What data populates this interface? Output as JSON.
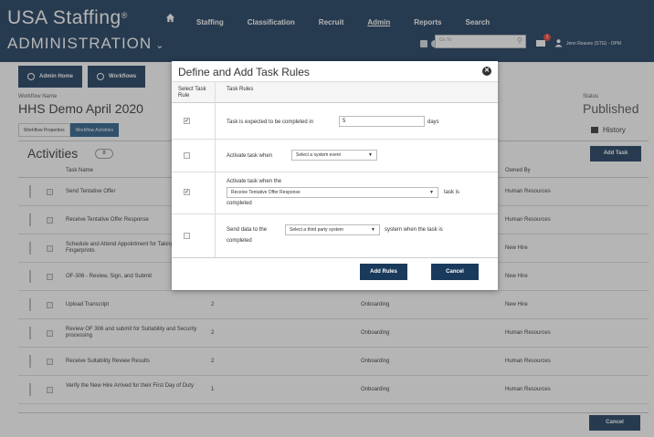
{
  "brand": {
    "name": "USA Staffing",
    "mark": "®"
  },
  "topnav": [
    {
      "label": "Staffing"
    },
    {
      "label": "Classification"
    },
    {
      "label": "Recruit"
    },
    {
      "label": "Admin"
    },
    {
      "label": "Reports"
    },
    {
      "label": "Search"
    }
  ],
  "section_title": "ADMINISTRATION",
  "goto_placeholder": "Go To",
  "notification_count": "3",
  "user_name": "Jenn Reaves (STG) - OPM",
  "subtabs": [
    {
      "label": "Admin Home",
      "icon": "gear-icon"
    },
    {
      "label": "Workflows",
      "icon": "refresh-icon"
    }
  ],
  "workflow": {
    "name_label": "Workflow Name",
    "name": "HHS Demo April 2020",
    "status_label": "Status",
    "status": "Published"
  },
  "crumbs": [
    "Workflow Properties",
    "Workflow Activities"
  ],
  "history_label": "History",
  "activities": {
    "title": "Activities",
    "count": "8",
    "add_task_label": "Add Task",
    "columns": {
      "name": "Task Name",
      "owner": "Owned By"
    },
    "rows": [
      {
        "name": "Send Tentative Offer",
        "num": "",
        "category": "",
        "owner": "Human Resources"
      },
      {
        "name": "Receive Tentative Offer Response",
        "num": "",
        "category": "",
        "owner": "Human Resources"
      },
      {
        "name": "Schedule and Attend Appointment for Taking Fingerprints",
        "num": "",
        "category": "",
        "owner": "New Hire"
      },
      {
        "name": "OF-306 - Review, Sign, and Submit",
        "num": "",
        "category": "",
        "owner": "New Hire"
      },
      {
        "name": "Upload Transcript",
        "num": "2",
        "category": "Onboarding",
        "owner": "New Hire"
      },
      {
        "name": "Review OF 306 and submit for Suitability and Security processing",
        "num": "2",
        "category": "Onboarding",
        "owner": "Human Resources"
      },
      {
        "name": "Receive Suitability Review Results",
        "num": "2",
        "category": "Onboarding",
        "owner": "Human Resources"
      },
      {
        "name": "Verify the New Hire Arrived for their First Day of Duty",
        "num": "1",
        "category": "Onboarding",
        "owner": "Human Resources"
      }
    ]
  },
  "bottom_cancel_label": "Cancel",
  "modal": {
    "title": "Define and Add Task Rules",
    "col_select": "Select Task Rule",
    "col_rules": "Task Rules",
    "rules": [
      {
        "checked": true,
        "prefix": "Task is expected to be completed in",
        "input": "5",
        "suffix": "days"
      },
      {
        "checked": false,
        "prefix": "Activate task when",
        "select": "Select a system event"
      },
      {
        "checked": true,
        "prefix": "Activate task when the",
        "select": "Receive Tentative Offer Response",
        "suffix": "task is",
        "line2": "completed"
      },
      {
        "checked": false,
        "prefix": "Send data to the",
        "select": "Select a third party system",
        "suffix": "system when the task is",
        "line2": "completed"
      }
    ],
    "add_label": "Add Rules",
    "cancel_label": "Cancel"
  },
  "colors": {
    "navy": "#1a3a5c",
    "accent": "#2b5d8a",
    "alert": "#e53935"
  }
}
